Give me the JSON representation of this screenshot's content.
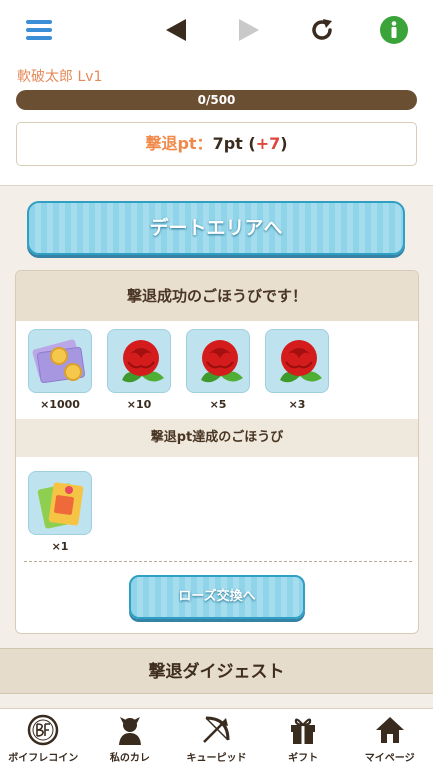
{
  "header": {
    "menu_icon": "hamburger-icon",
    "back_icon": "triangle-left-icon",
    "forward_icon": "triangle-right-icon",
    "reload_icon": "reload-icon",
    "info_icon": "info-icon",
    "accent": "#3b8fd6",
    "info_color": "#3aa33a"
  },
  "user": {
    "name": "軟破太郎 Lv1",
    "xp": "0/500",
    "xp_progress": 0,
    "pt_label": "撃退pt：",
    "pt_value": "7pt",
    "pt_bonus_open": "(",
    "pt_bonus": "+7",
    "pt_bonus_close": ")"
  },
  "buttons": {
    "date_area": "デートエリアへ",
    "rose_exchange": "ローズ交換へ"
  },
  "rewards": {
    "title": "撃退成功のごほうびです！",
    "items": [
      {
        "icon": "coins-icon",
        "qty": "×1000"
      },
      {
        "icon": "rose-icon",
        "qty": "×10"
      },
      {
        "icon": "rose-icon",
        "qty": "×5"
      },
      {
        "icon": "rose-icon",
        "qty": "×3"
      }
    ],
    "pt_title": "撃退pt達成のごほうび",
    "pt_items": [
      {
        "icon": "gift-bag-icon",
        "qty": "×1"
      }
    ]
  },
  "digest": {
    "title": "撃退ダイジェスト"
  },
  "nav": [
    {
      "label": "ボイフレコイン",
      "icon": "boifure-coin-icon"
    },
    {
      "label": "私のカレ",
      "icon": "boyfriend-icon"
    },
    {
      "label": "キューピッド",
      "icon": "bow-arrow-icon"
    },
    {
      "label": "ギフト",
      "icon": "gift-icon"
    },
    {
      "label": "マイページ",
      "icon": "house-icon"
    }
  ]
}
